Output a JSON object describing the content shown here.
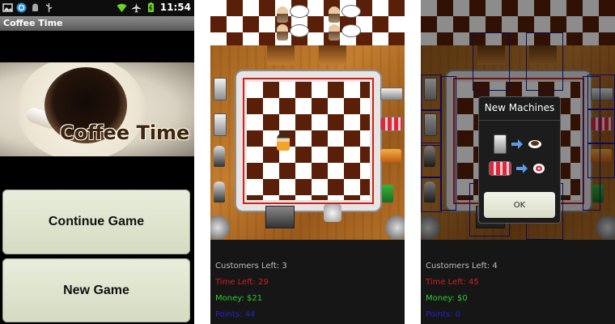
{
  "colors": {
    "time_text": "#d12020",
    "money_text": "#2ecc2e",
    "points_text": "#2222cc",
    "customers_text": "#bdbdbd",
    "button_bg": "#e3e8d3",
    "zone_outline": "#1414a8"
  },
  "main_menu": {
    "status_bar": {
      "time": "11:54",
      "icons": [
        "photo-icon",
        "sync-icon",
        "android-icon",
        "usb-icon",
        "wifi-icon",
        "airplane-icon",
        "battery-icon"
      ]
    },
    "title": "Coffee Time",
    "logo_text": "Coffee Time",
    "buttons": {
      "continue": "Continue Game",
      "new_game": "New Game"
    }
  },
  "game_screen": {
    "customers_label": "Customers Left: 3",
    "time_label": "Time Left: 29",
    "money_label": "Money: $21",
    "points_label": "Points: 44"
  },
  "new_machines_screen": {
    "dialog": {
      "title": "New Machines",
      "ok": "OK",
      "items": [
        {
          "from": "coffee-maker-icon",
          "to": "coffee-cup-icon"
        },
        {
          "from": "donut-rack-icon",
          "to": "donut-icon"
        }
      ]
    },
    "customers_label": "Customers Left: 4",
    "time_label": "Time Left: 45",
    "money_label": "Money: $0",
    "points_label": "Points: 0"
  }
}
